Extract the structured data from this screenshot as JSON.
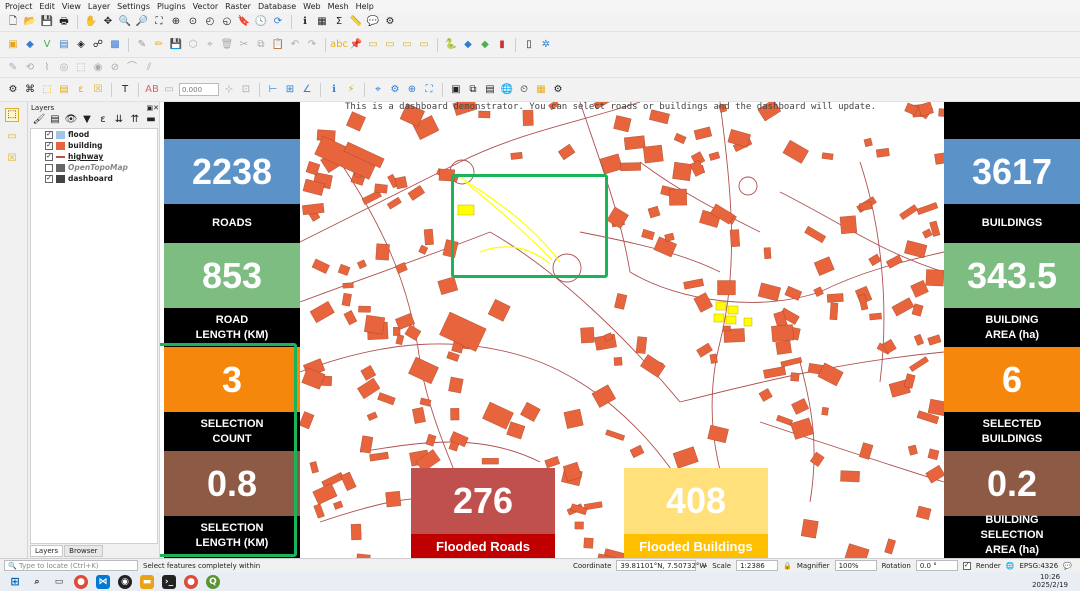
{
  "menu": [
    "Project",
    "Edit",
    "View",
    "Layer",
    "Settings",
    "Plugins",
    "Vector",
    "Raster",
    "Database",
    "Web",
    "Mesh",
    "Help"
  ],
  "toolbar": {
    "scale_combo": "0.000"
  },
  "layers_panel": {
    "title": "Layers",
    "items": [
      {
        "name": "flood",
        "checked": true,
        "color": "#9fc5e8"
      },
      {
        "name": "building",
        "checked": true,
        "color": "#e8643c"
      },
      {
        "name": "highway",
        "checked": true,
        "color": "#c0504d"
      },
      {
        "name": "OpenTopoMap",
        "checked": false,
        "color": "#666666"
      },
      {
        "name": "dashboard",
        "checked": true,
        "color": "#444444"
      }
    ],
    "tabs": [
      "Layers",
      "Browser"
    ]
  },
  "map": {
    "demo_text": "This is a dashboard demonstrator. You can select roads or buildings and the dashboard will update.",
    "selection_color": "#ffff00",
    "building_color": "#e8643c"
  },
  "dashboard": {
    "left": [
      {
        "value": "2238",
        "label": "ROADS",
        "color": "#5b93c9"
      },
      {
        "value": "853",
        "label": "ROAD\nLENGTH (KM)",
        "color": "#7dbd82"
      },
      {
        "value": "3",
        "label": "SELECTION\nCOUNT",
        "color": "#f5870d"
      },
      {
        "value": "0.8",
        "label": "SELECTION\nLENGTH (KM)",
        "color": "#8d5a45"
      }
    ],
    "right": [
      {
        "value": "3617",
        "label": "BUILDINGS",
        "color": "#5b93c9"
      },
      {
        "value": "343.5",
        "label": "BUILDING\nAREA (ha)",
        "color": "#7dbd82"
      },
      {
        "value": "6",
        "label": "SELECTED\nBUILDINGS",
        "color": "#f5870d"
      },
      {
        "value": "0.2",
        "label": "BUILDING\nSELECTION\nAREA (ha)",
        "color": "#8d5a45"
      }
    ],
    "bottom": [
      {
        "value": "276",
        "label": "Flooded Roads",
        "color": "#c0504d",
        "label_bg": "#c00000"
      },
      {
        "value": "408",
        "label": "Flooded Buildings",
        "color": "#ffe07a",
        "label_bg": "#ffc000"
      }
    ]
  },
  "statusbar": {
    "locate_placeholder": "Type to locate (Ctrl+K)",
    "message": "Select features completely within",
    "coordinate_label": "Coordinate",
    "coordinate": "39.81101°N, 7.50732°W",
    "scale_label": "Scale",
    "scale": "1:2386",
    "magnifier_label": "Magnifier",
    "magnifier": "100%",
    "rotation_label": "Rotation",
    "rotation": "0.0 °",
    "render_label": "Render",
    "crs": "EPSG:4326"
  },
  "taskbar": {
    "time": "10:26",
    "date": "2025/2/19"
  }
}
